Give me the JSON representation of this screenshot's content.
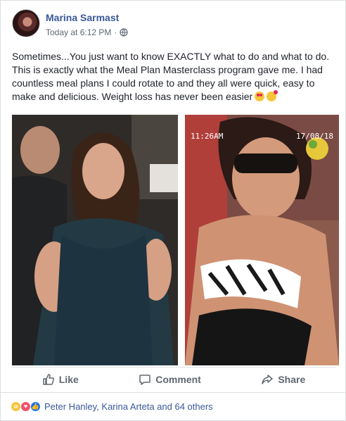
{
  "post": {
    "author": "Marina Sarmast",
    "timestamp": "Today at 6:12 PM",
    "privacy_icon": "globe-icon",
    "text": "Sometimes...You just want to know EXACTLY what to do and what to do. This is exactly what the Meal Plan Masterclass program gave me. I had countless meal plans I could rotate to and they all were quick, easy to make and delicious. Weight loss has never been easier",
    "emojis": [
      "heart-eyes-emoji",
      "smiling-face-with-hearts-emoji"
    ]
  },
  "photos": {
    "right_overlay_time": "11:26AM",
    "right_overlay_date": "17/08/18"
  },
  "actions": {
    "like_label": "Like",
    "comment_label": "Comment",
    "share_label": "Share"
  },
  "reactions": {
    "types": [
      "wow",
      "love",
      "like"
    ],
    "summary": "Peter Hanley, Karina Arteta and 64 others"
  },
  "colors": {
    "author_link": "#385898",
    "meta_text": "#606770",
    "body_text": "#1d2129",
    "like_blue": "#1877f2",
    "love_red": "#f25268",
    "wow_yellow": "#f7c53a"
  }
}
